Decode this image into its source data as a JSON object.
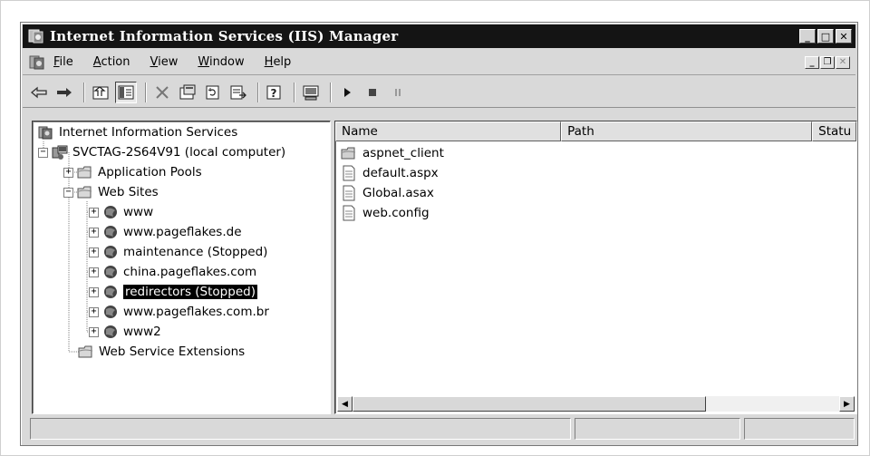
{
  "window": {
    "title": "Internet Information Services (IIS) Manager"
  },
  "title_controls": {
    "minimize": "_",
    "maximize": "□",
    "close": "✕"
  },
  "menu": [
    {
      "label": "File",
      "u": "F",
      "rest": "ile"
    },
    {
      "label": "Action",
      "u": "A",
      "rest": "ction"
    },
    {
      "label": "View",
      "u": "V",
      "rest": "iew"
    },
    {
      "label": "Window",
      "u": "W",
      "rest": "indow"
    },
    {
      "label": "Help",
      "u": "H",
      "rest": "elp"
    }
  ],
  "mdi_controls": {
    "minimize": "_",
    "restore": "❐",
    "close": "✕"
  },
  "toolbar": {
    "buttons": [
      "back-icon",
      "forward-icon",
      "up-one-level-icon",
      "show-hide-tree-icon",
      "delete-icon",
      "properties-icon",
      "refresh-icon",
      "export-list-icon",
      "help-icon",
      "computer-icon",
      "start-icon",
      "stop-icon",
      "pause-icon"
    ]
  },
  "tree": {
    "root": "Internet Information Services",
    "computer": "SVCTAG-2S64V91 (local computer)",
    "app_pools": "Application Pools",
    "web_sites": "Web Sites",
    "sites": [
      {
        "label": "www",
        "selected": false
      },
      {
        "label": "www.pageflakes.de",
        "selected": false
      },
      {
        "label": "maintenance (Stopped)",
        "selected": false
      },
      {
        "label": "china.pageflakes.com",
        "selected": false
      },
      {
        "label": "redirectors (Stopped)",
        "selected": true
      },
      {
        "label": "www.pageflakes.com.br",
        "selected": false
      },
      {
        "label": "www2",
        "selected": false
      }
    ],
    "extensions": "Web Service Extensions",
    "expand_plus": "+",
    "expand_minus": "−"
  },
  "list": {
    "columns": [
      "Name",
      "Path",
      "Statu"
    ],
    "items": [
      {
        "name": "aspnet_client",
        "icon": "folder-icon"
      },
      {
        "name": "default.aspx",
        "icon": "file-icon"
      },
      {
        "name": "Global.asax",
        "icon": "file-icon"
      },
      {
        "name": "web.config",
        "icon": "file-icon"
      }
    ]
  },
  "scrollbar": {
    "left": "◀",
    "right": "▶"
  },
  "status": [
    "",
    "",
    ""
  ]
}
